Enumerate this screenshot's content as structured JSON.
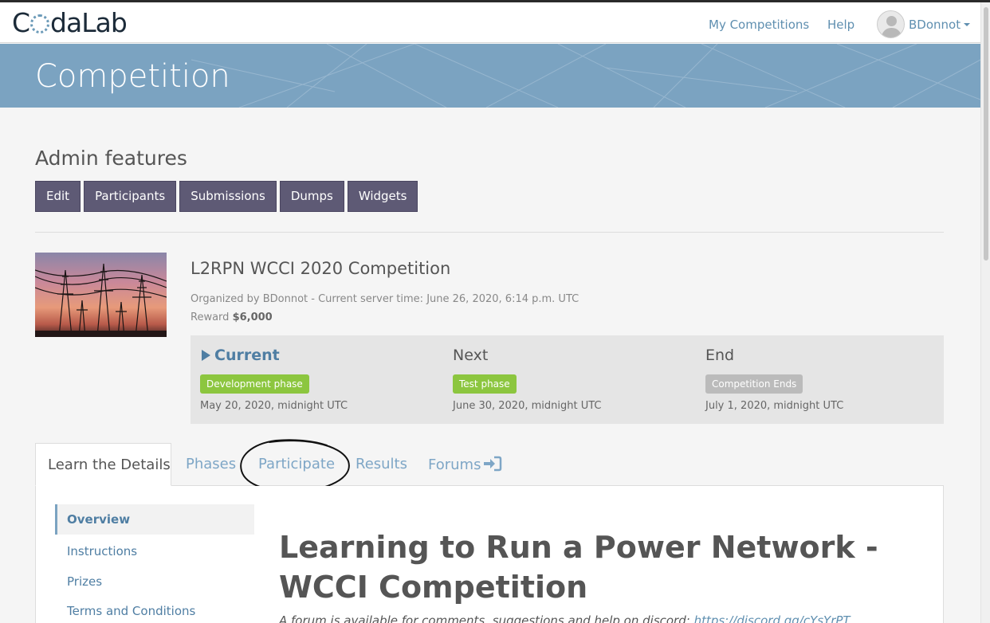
{
  "navbar": {
    "logo_prefix": "C",
    "logo_suffix": "daLab",
    "my_competitions": "My Competitions",
    "help": "Help",
    "username": "BDonnot"
  },
  "banner": {
    "title": "Competition"
  },
  "admin": {
    "title": "Admin features",
    "buttons": [
      "Edit",
      "Participants",
      "Submissions",
      "Dumps",
      "Widgets"
    ]
  },
  "competition": {
    "title": "L2RPN WCCI 2020 Competition",
    "organizer_line": "Organized by BDonnot - Current server time: June 26, 2020, 6:14 p.m. UTC",
    "reward_label": "Reward",
    "reward_value": "$6,000",
    "phases": [
      {
        "heading": "Current",
        "badge": "Development phase",
        "date": "May 20, 2020, midnight UTC",
        "badge_color": "#8cc63f"
      },
      {
        "heading": "Next",
        "badge": "Test phase",
        "date": "June 30, 2020, midnight UTC",
        "badge_color": "#8cc63f"
      },
      {
        "heading": "End",
        "badge": "Competition Ends",
        "date": "July 1, 2020, midnight UTC",
        "badge_color": "#bbbbbb"
      }
    ]
  },
  "tabs": [
    "Learn the Details",
    "Phases",
    "Participate",
    "Results",
    "Forums"
  ],
  "sidebar": [
    "Overview",
    "Instructions",
    "Prizes",
    "Terms and Conditions"
  ],
  "content": {
    "heading": "Learning to Run a Power Network - WCCI Competition",
    "note_text": "A forum is available for comments, suggestions and help on discord: ",
    "note_link": "https://discord.gg/cYsYrPT"
  },
  "colors": {
    "accent": "#7ba3c1",
    "admin_button": "#5e5a75",
    "link": "#5f8fb0"
  }
}
